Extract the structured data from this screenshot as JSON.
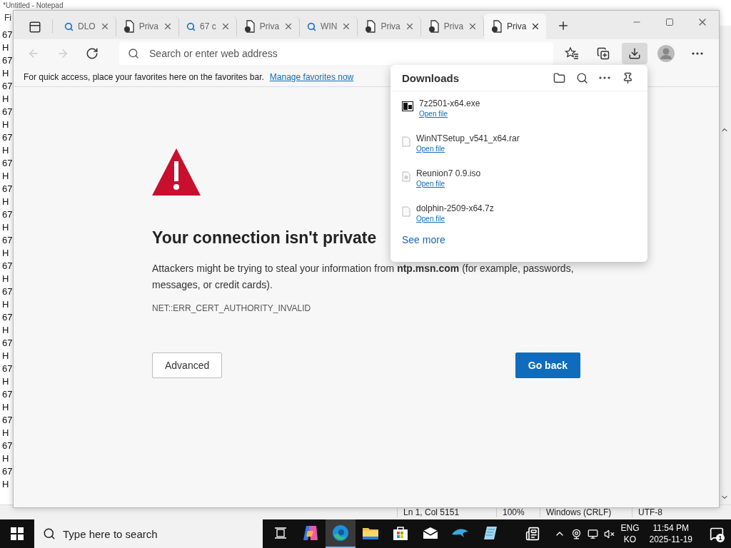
{
  "notepad": {
    "title": "*Untitled - Notepad",
    "menu": [
      "Fi"
    ],
    "lines": [
      "67",
      "H",
      "67",
      "H",
      "67",
      "H",
      "67",
      "H",
      "67",
      "H",
      "67",
      "H",
      "67",
      "H",
      "67",
      "H",
      "67",
      "H",
      "67",
      "H",
      "67",
      "H",
      "67",
      "H",
      "67",
      "H",
      "67",
      "H",
      "67",
      "H",
      "67",
      "H",
      "67",
      "H",
      "67",
      "H"
    ],
    "status_bar": [
      "Ln 1, Col 5151",
      "100%",
      "Windows (CRLF)",
      "UTF-8"
    ]
  },
  "browser": {
    "tabs": [
      {
        "kind": "search",
        "label": "DLO",
        "selected": false
      },
      {
        "kind": "page",
        "label": "Priva",
        "selected": false
      },
      {
        "kind": "search",
        "label": "67 c",
        "selected": false
      },
      {
        "kind": "page",
        "label": "Priva",
        "selected": false
      },
      {
        "kind": "search",
        "label": "WIN",
        "selected": false
      },
      {
        "kind": "page",
        "label": "Priva",
        "selected": false
      },
      {
        "kind": "page",
        "label": "Priva",
        "selected": false
      },
      {
        "kind": "page",
        "label": "Priva",
        "selected": true
      }
    ],
    "address": {
      "placeholder": "Search or enter web address"
    },
    "toolbar": [
      {
        "kind": "favorites",
        "selected": false
      },
      {
        "kind": "collections",
        "selected": false
      },
      {
        "kind": "downloads",
        "selected": true
      },
      {
        "kind": "profile",
        "selected": false
      },
      {
        "kind": "more",
        "selected": false
      }
    ],
    "favorites_bar": {
      "text": "For quick access, place your favorites here on the favorites bar.",
      "link": "Manage favorites now"
    },
    "page": {
      "heading": "Your connection isn't private",
      "message": "Attackers might be trying to steal your information from **ntp.msn.com** (for example, passwords, messages, or credit cards).",
      "error_code": "NET::ERR_CERT_AUTHORITY_INVALID",
      "buttons": [
        {
          "kind": "secondary",
          "label": "Advanced"
        },
        {
          "kind": "primary",
          "label": "Go back"
        }
      ]
    },
    "downloads": {
      "title": "Downloads",
      "items": [
        {
          "kind": "app",
          "name": "7z2501-x64.exe",
          "action": "Open file"
        },
        {
          "kind": "file",
          "name": "WinNTSetup_v541_x64.rar",
          "action": "Open file"
        },
        {
          "kind": "disc",
          "name": "Reunion7 0.9.iso",
          "action": "Open file"
        },
        {
          "kind": "file",
          "name": "dolphin-2509-x64.7z",
          "action": "Open file"
        }
      ],
      "see_more": "See more"
    }
  },
  "taskbar": {
    "search": {
      "placeholder": "Type here to search"
    },
    "apps": [
      {
        "kind": "taskview",
        "selected": false
      },
      {
        "kind": "copilot",
        "selected": false
      },
      {
        "kind": "edge",
        "selected": true
      },
      {
        "kind": "explorer",
        "selected": false
      },
      {
        "kind": "store",
        "selected": false
      },
      {
        "kind": "mail",
        "selected": false
      },
      {
        "kind": "dolphin",
        "selected": false
      },
      {
        "kind": "notepad",
        "selected": false
      }
    ],
    "language": [
      "ENG",
      "KO"
    ],
    "time": "11:54 PM",
    "date": "2025-11-19",
    "notifications": "1"
  }
}
